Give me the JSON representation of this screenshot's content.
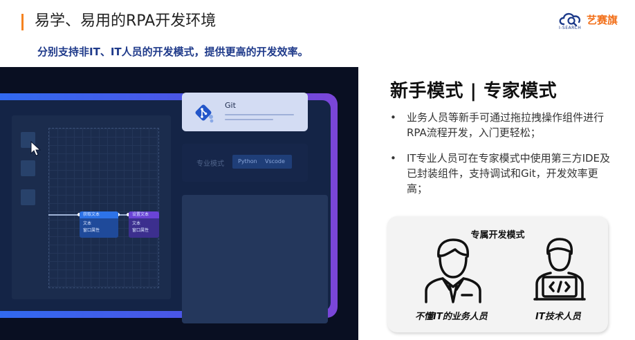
{
  "header": {
    "title": "易学、易用的RPA开发环境",
    "subtitle": "分别支持非IT、IT人员的开发模式，提供更高的开发效率。",
    "accent_color": "#f5821f"
  },
  "logo": {
    "name": "艺赛旗",
    "tagline": "I-SEARCH",
    "icon": "cloud-logo-icon"
  },
  "screenshot": {
    "git_card": {
      "label": "Git",
      "icon": "git-icon"
    },
    "mode_card": {
      "label": "专业模式",
      "options": [
        "Python",
        "Vscode"
      ]
    },
    "nodes": [
      {
        "title": "获取文本",
        "lines": [
          "文本",
          "窗口属性"
        ]
      },
      {
        "title": "设置文本",
        "lines": [
          "文本",
          "窗口属性"
        ]
      }
    ],
    "cursor_icon": "mouse-pointer-icon"
  },
  "content": {
    "heading": "新手模式 | 专家模式",
    "bullets": [
      "业务人员等新手可通过拖拉拽操作组件进行RPA流程开发，入门更轻松；",
      "IT专业人员可在专家模式中使用第三方IDE及已封装组件，支持调试和Git，开发效率更高；"
    ]
  },
  "mode_box": {
    "title": "专属开发模式",
    "personas": [
      {
        "label": "不懂IT的业务人员",
        "icon": "business-person-icon"
      },
      {
        "label": "IT技术人员",
        "icon": "developer-person-icon"
      }
    ]
  }
}
